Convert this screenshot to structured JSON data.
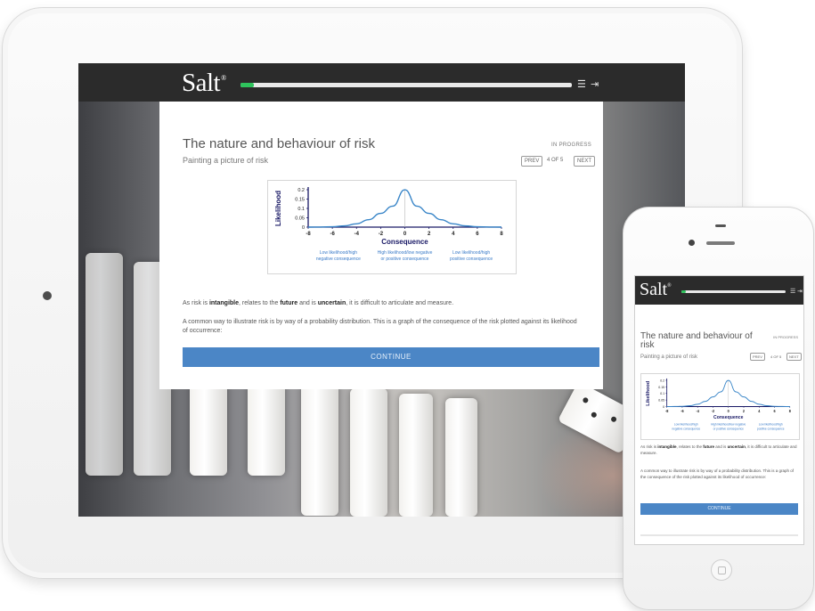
{
  "app": {
    "logo": "Salt",
    "logo_mark": "®",
    "progress_fraction": 0.04,
    "menu_icon": "list-icon",
    "exit_icon": "exit-icon"
  },
  "lesson": {
    "title": "The nature and behaviour of risk",
    "subtitle": "Painting a picture of risk",
    "status": "IN PROGRESS",
    "prev_label": "PREV",
    "page_count": "4 OF 5",
    "next_label": "NEXT"
  },
  "body": {
    "p1_a": "As risk is ",
    "p1_b": "intangible",
    "p1_c": ", relates to the ",
    "p1_d": "future",
    "p1_e": " and is ",
    "p1_f": "uncertain",
    "p1_g": ", it is difficult to articulate and measure.",
    "p2": "A common way to illustrate risk is by way of a probability distribution. This is a graph of the consequence of the risk plotted against its likelihood of occurrence:",
    "continue_label": "CONTINUE"
  },
  "chart_data": {
    "type": "line",
    "title": "",
    "xlabel": "Consequence",
    "ylabel": "Likelihood",
    "xlim": [
      -8,
      8
    ],
    "ylim": [
      0,
      0.2
    ],
    "xticks": [
      -8,
      -6,
      -4,
      -2,
      0,
      2,
      4,
      6,
      8
    ],
    "yticks": [
      0,
      0.05,
      0.1,
      0.15,
      0.2
    ],
    "ytick_labels": [
      "0",
      "0.05",
      "0.1",
      "0.15",
      "0.2"
    ],
    "series": [
      {
        "x": [
          -8,
          -7,
          -6,
          -5,
          -4,
          -3,
          -2,
          -1,
          0,
          1,
          2,
          3,
          4,
          5,
          6,
          7,
          8
        ],
        "values": [
          0.0,
          0.0005,
          0.002,
          0.0065,
          0.0176,
          0.0397,
          0.0737,
          0.1122,
          0.1995,
          0.1122,
          0.0737,
          0.0397,
          0.0176,
          0.0065,
          0.002,
          0.0005,
          0.0
        ]
      }
    ],
    "annotations": [
      {
        "text": [
          "Low likelihood/high",
          "negative consequence"
        ],
        "x": -5.5
      },
      {
        "text": [
          "High likelihood/low negative",
          "or positive consequence"
        ],
        "x": 0
      },
      {
        "text": [
          "Low likelihood/high",
          "positive consequence"
        ],
        "x": 5.5
      }
    ],
    "colors": {
      "curve": "#3a86c8",
      "axis": "#1a1a66",
      "annotation": "#3a7bc8"
    }
  }
}
